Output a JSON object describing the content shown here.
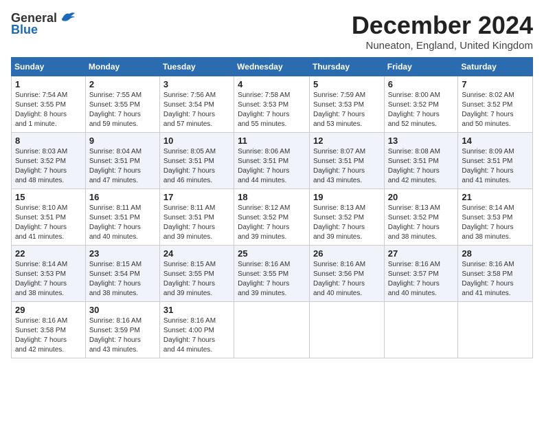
{
  "logo": {
    "general": "General",
    "blue": "Blue"
  },
  "header": {
    "title": "December 2024",
    "location": "Nuneaton, England, United Kingdom"
  },
  "calendar": {
    "days_of_week": [
      "Sunday",
      "Monday",
      "Tuesday",
      "Wednesday",
      "Thursday",
      "Friday",
      "Saturday"
    ],
    "weeks": [
      [
        {
          "day": "1",
          "info": "Sunrise: 7:54 AM\nSunset: 3:55 PM\nDaylight: 8 hours\nand 1 minute."
        },
        {
          "day": "2",
          "info": "Sunrise: 7:55 AM\nSunset: 3:55 PM\nDaylight: 7 hours\nand 59 minutes."
        },
        {
          "day": "3",
          "info": "Sunrise: 7:56 AM\nSunset: 3:54 PM\nDaylight: 7 hours\nand 57 minutes."
        },
        {
          "day": "4",
          "info": "Sunrise: 7:58 AM\nSunset: 3:53 PM\nDaylight: 7 hours\nand 55 minutes."
        },
        {
          "day": "5",
          "info": "Sunrise: 7:59 AM\nSunset: 3:53 PM\nDaylight: 7 hours\nand 53 minutes."
        },
        {
          "day": "6",
          "info": "Sunrise: 8:00 AM\nSunset: 3:52 PM\nDaylight: 7 hours\nand 52 minutes."
        },
        {
          "day": "7",
          "info": "Sunrise: 8:02 AM\nSunset: 3:52 PM\nDaylight: 7 hours\nand 50 minutes."
        }
      ],
      [
        {
          "day": "8",
          "info": "Sunrise: 8:03 AM\nSunset: 3:52 PM\nDaylight: 7 hours\nand 48 minutes."
        },
        {
          "day": "9",
          "info": "Sunrise: 8:04 AM\nSunset: 3:51 PM\nDaylight: 7 hours\nand 47 minutes."
        },
        {
          "day": "10",
          "info": "Sunrise: 8:05 AM\nSunset: 3:51 PM\nDaylight: 7 hours\nand 46 minutes."
        },
        {
          "day": "11",
          "info": "Sunrise: 8:06 AM\nSunset: 3:51 PM\nDaylight: 7 hours\nand 44 minutes."
        },
        {
          "day": "12",
          "info": "Sunrise: 8:07 AM\nSunset: 3:51 PM\nDaylight: 7 hours\nand 43 minutes."
        },
        {
          "day": "13",
          "info": "Sunrise: 8:08 AM\nSunset: 3:51 PM\nDaylight: 7 hours\nand 42 minutes."
        },
        {
          "day": "14",
          "info": "Sunrise: 8:09 AM\nSunset: 3:51 PM\nDaylight: 7 hours\nand 41 minutes."
        }
      ],
      [
        {
          "day": "15",
          "info": "Sunrise: 8:10 AM\nSunset: 3:51 PM\nDaylight: 7 hours\nand 41 minutes."
        },
        {
          "day": "16",
          "info": "Sunrise: 8:11 AM\nSunset: 3:51 PM\nDaylight: 7 hours\nand 40 minutes."
        },
        {
          "day": "17",
          "info": "Sunrise: 8:11 AM\nSunset: 3:51 PM\nDaylight: 7 hours\nand 39 minutes."
        },
        {
          "day": "18",
          "info": "Sunrise: 8:12 AM\nSunset: 3:52 PM\nDaylight: 7 hours\nand 39 minutes."
        },
        {
          "day": "19",
          "info": "Sunrise: 8:13 AM\nSunset: 3:52 PM\nDaylight: 7 hours\nand 39 minutes."
        },
        {
          "day": "20",
          "info": "Sunrise: 8:13 AM\nSunset: 3:52 PM\nDaylight: 7 hours\nand 38 minutes."
        },
        {
          "day": "21",
          "info": "Sunrise: 8:14 AM\nSunset: 3:53 PM\nDaylight: 7 hours\nand 38 minutes."
        }
      ],
      [
        {
          "day": "22",
          "info": "Sunrise: 8:14 AM\nSunset: 3:53 PM\nDaylight: 7 hours\nand 38 minutes."
        },
        {
          "day": "23",
          "info": "Sunrise: 8:15 AM\nSunset: 3:54 PM\nDaylight: 7 hours\nand 38 minutes."
        },
        {
          "day": "24",
          "info": "Sunrise: 8:15 AM\nSunset: 3:55 PM\nDaylight: 7 hours\nand 39 minutes."
        },
        {
          "day": "25",
          "info": "Sunrise: 8:16 AM\nSunset: 3:55 PM\nDaylight: 7 hours\nand 39 minutes."
        },
        {
          "day": "26",
          "info": "Sunrise: 8:16 AM\nSunset: 3:56 PM\nDaylight: 7 hours\nand 40 minutes."
        },
        {
          "day": "27",
          "info": "Sunrise: 8:16 AM\nSunset: 3:57 PM\nDaylight: 7 hours\nand 40 minutes."
        },
        {
          "day": "28",
          "info": "Sunrise: 8:16 AM\nSunset: 3:58 PM\nDaylight: 7 hours\nand 41 minutes."
        }
      ],
      [
        {
          "day": "29",
          "info": "Sunrise: 8:16 AM\nSunset: 3:58 PM\nDaylight: 7 hours\nand 42 minutes."
        },
        {
          "day": "30",
          "info": "Sunrise: 8:16 AM\nSunset: 3:59 PM\nDaylight: 7 hours\nand 43 minutes."
        },
        {
          "day": "31",
          "info": "Sunrise: 8:16 AM\nSunset: 4:00 PM\nDaylight: 7 hours\nand 44 minutes."
        },
        {
          "day": "",
          "info": ""
        },
        {
          "day": "",
          "info": ""
        },
        {
          "day": "",
          "info": ""
        },
        {
          "day": "",
          "info": ""
        }
      ]
    ]
  }
}
